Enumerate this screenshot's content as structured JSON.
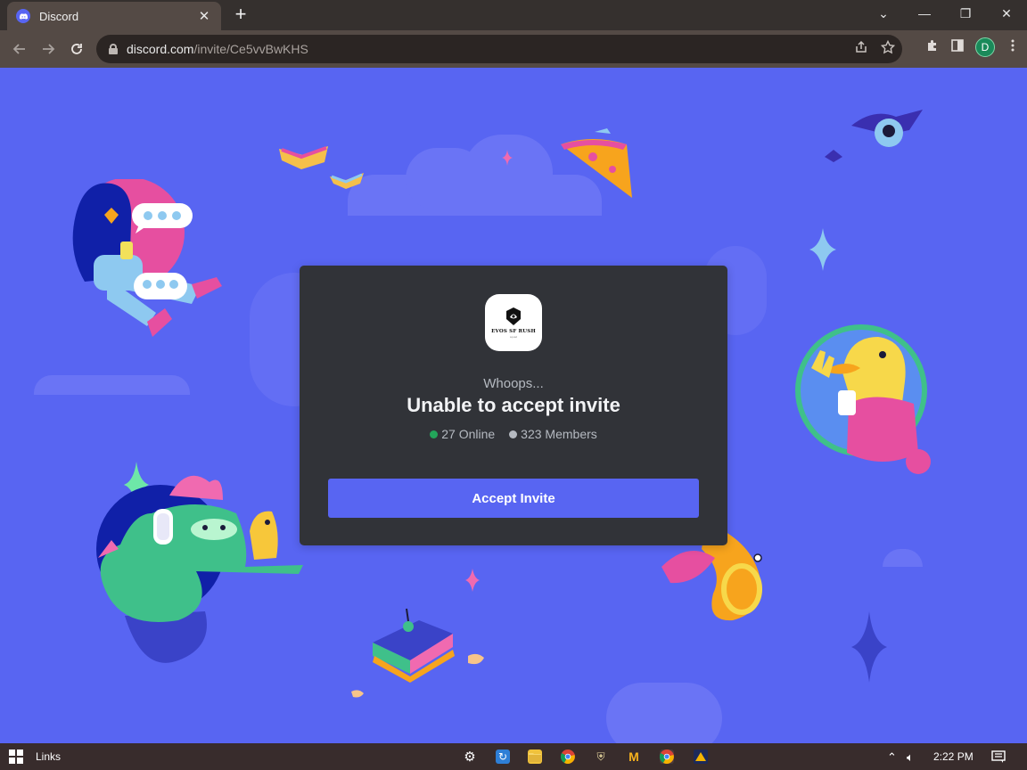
{
  "browser": {
    "tab_title": "Discord",
    "tab_close": "✕",
    "new_tab": "+",
    "url_host": "discord.com",
    "url_path": "/invite/Ce5vvBwKHS",
    "profile_initial": "D",
    "window_controls": {
      "dropdown": "⌄",
      "minimize": "—",
      "restore": "❐",
      "close": "✕"
    }
  },
  "invite": {
    "server_name": "EVOS SF RUSH",
    "server_tagline": "squad",
    "whoops": "Whoops...",
    "headline": "Unable to accept invite",
    "online": "27 Online",
    "members": "323 Members",
    "button": "Accept Invite",
    "online_color": "#23a55a",
    "members_color": "#b5bac1"
  },
  "taskbar": {
    "links_label": "Links",
    "time": "2:22 PM"
  },
  "colors": {
    "blurple": "#5865f2",
    "modal_bg": "#313338"
  }
}
